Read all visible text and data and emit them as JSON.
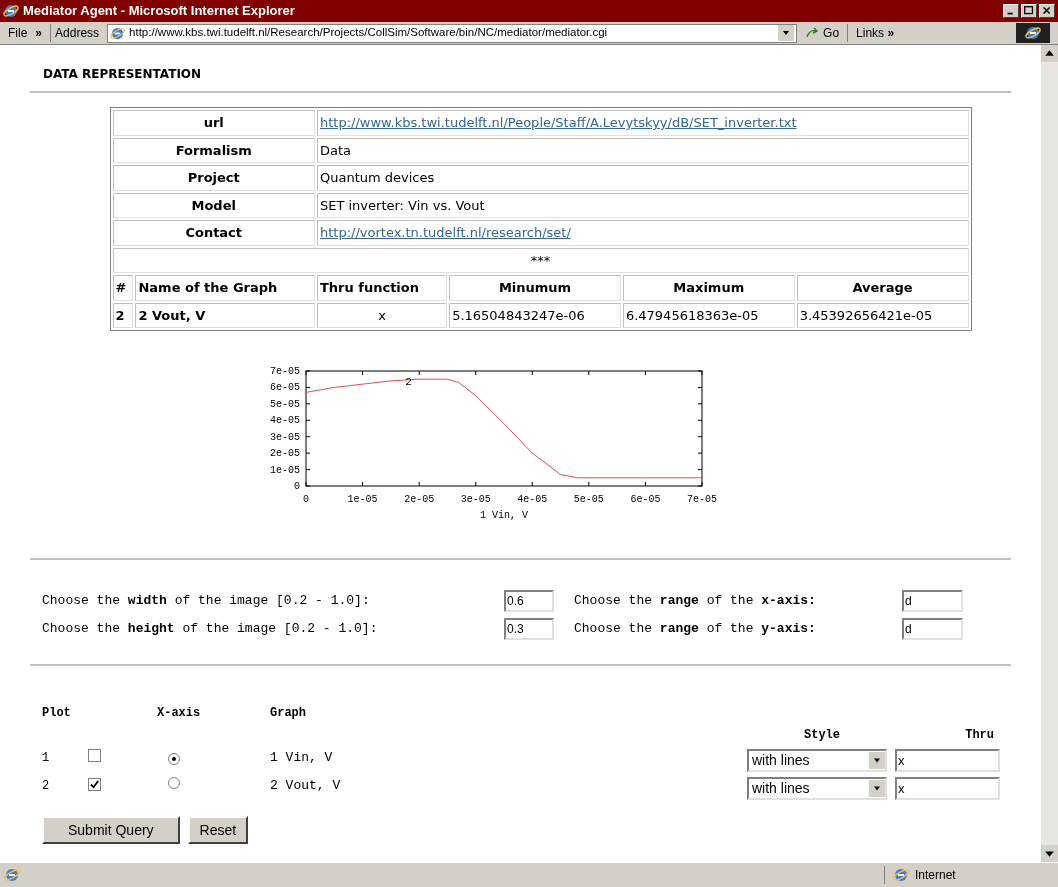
{
  "window": {
    "title": "Mediator Agent - Microsoft Internet Explorer"
  },
  "toolbar": {
    "menu": "File",
    "chevron": "»",
    "address_label": "Address",
    "url": "http://www.kbs.twi.tudelft.nl/Research/Projects/CollSim/Software/bin/NC/mediator/mediator.cgi",
    "go": "Go",
    "links": "Links",
    "links_chevron": "»"
  },
  "heading": "DATA REPRESENTATION",
  "info_rows": [
    {
      "label": "url",
      "value": "http://www.kbs.twi.tudelft.nl/People/Staff/A.Levytskyy/dB/SET_inverter.txt",
      "kind": "link"
    },
    {
      "label": "Formalism",
      "value": "Data",
      "kind": "text"
    },
    {
      "label": "Project",
      "value": "Quantum devices",
      "kind": "text"
    },
    {
      "label": "Model",
      "value": "SET inverter: Vin vs. Vout",
      "kind": "text"
    },
    {
      "label": "Contact",
      "value": "http://vortex.tn.tudelft.nl/research/set/",
      "kind": "link"
    }
  ],
  "separator": "***",
  "graph_table": {
    "columns": [
      "#",
      "Name of the Graph",
      "Thru function",
      "Minumum",
      "Maximum",
      "Average"
    ],
    "rows": [
      [
        "2",
        "2 Vout, V",
        "x",
        "5.16504843247e-06",
        "6.47945618363e-05",
        "3.45392656421e-05"
      ]
    ]
  },
  "chart": {
    "chart_data": {
      "type": "line",
      "xlabel": "1 Vin, V",
      "xlim": [
        0,
        7e-05
      ],
      "ylim": [
        0,
        7e-05
      ],
      "x": [
        0,
        5e-06,
        1e-05,
        1.5e-05,
        2e-05,
        2.5e-05,
        2.7e-05,
        3e-05,
        3.5e-05,
        4e-05,
        4.5e-05,
        4.8e-05,
        5e-05,
        6e-05,
        7e-05
      ],
      "series": [
        {
          "name": "2",
          "color": "#e05050",
          "values": [
            5.7e-05,
            6e-05,
            6.2e-05,
            6.4e-05,
            6.5e-05,
            6.5e-05,
            6.3e-05,
            5.5e-05,
            3.8e-05,
            2e-05,
            7e-06,
            5e-06,
            5e-06,
            5e-06,
            5e-06
          ]
        }
      ],
      "xticks": [
        {
          "value": 0,
          "label": "0"
        },
        {
          "value": 1e-05,
          "label": "1e-05"
        },
        {
          "value": 2e-05,
          "label": "2e-05"
        },
        {
          "value": 3e-05,
          "label": "3e-05"
        },
        {
          "value": 4e-05,
          "label": "4e-05"
        },
        {
          "value": 5e-05,
          "label": "5e-05"
        },
        {
          "value": 6e-05,
          "label": "6e-05"
        },
        {
          "value": 7e-05,
          "label": "7e-05"
        }
      ],
      "yticks": [
        {
          "value": 0,
          "label": "0"
        },
        {
          "value": 1e-05,
          "label": "1e-05"
        },
        {
          "value": 2e-05,
          "label": "2e-05"
        },
        {
          "value": 3e-05,
          "label": "3e-05"
        },
        {
          "value": 4e-05,
          "label": "4e-05"
        },
        {
          "value": 5e-05,
          "label": "5e-05"
        },
        {
          "value": 6e-05,
          "label": "6e-05"
        },
        {
          "value": 7e-05,
          "label": "7e-05"
        }
      ]
    }
  },
  "image_options": [
    {
      "text": "Choose the **width** of the image [0.2 - 1.0]:",
      "value": "0.6",
      "range_text": "Choose the **range** of the **x-axis:**",
      "range_value": "d"
    },
    {
      "text": "Choose the **height** of the image [0.2 - 1.0]:",
      "value": "0.3",
      "range_text": "Choose the **range** of the **y-axis:**",
      "range_value": "d"
    }
  ],
  "plot": {
    "headers": [
      "Plot",
      "X-axis",
      "Graph"
    ],
    "style_header": "Style",
    "thru_header": "Thru",
    "rows": [
      {
        "number": "1",
        "plot_checked": false,
        "xaxis_selected": true,
        "graph": "1 Vin, V",
        "style": "with lines",
        "thru": "x"
      },
      {
        "number": "2",
        "plot_checked": true,
        "xaxis_selected": false,
        "graph": "2 Vout, V",
        "style": "with lines",
        "thru": "x"
      }
    ]
  },
  "buttons": [
    "Submit Query",
    "Reset"
  ],
  "status_bar": {
    "zone": "Internet"
  }
}
